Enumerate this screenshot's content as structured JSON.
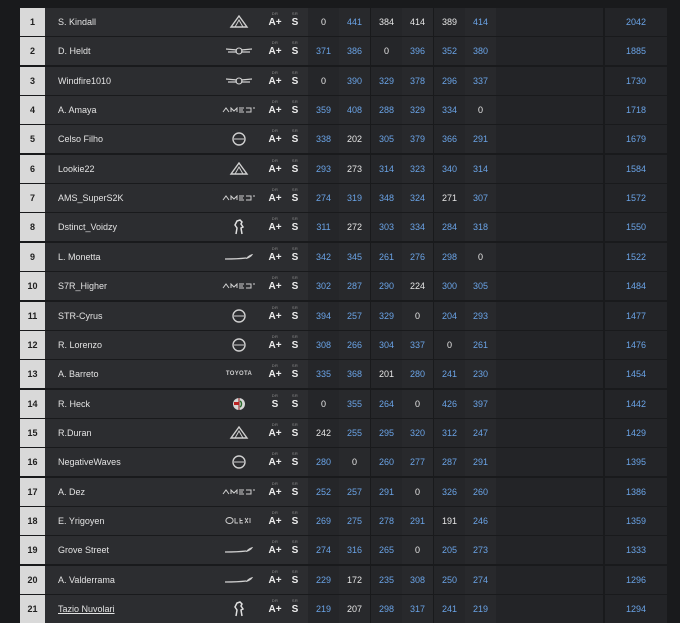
{
  "license_caps": {
    "dr": "DR",
    "sr": "SR"
  },
  "brand_colors": {
    "round_value": "#6aa3e6",
    "highlight_value": "#e6e6e6"
  },
  "rows": [
    {
      "pos": "1",
      "name": "S. Kindall",
      "logo": "alpine",
      "dr": "A+",
      "sr": "S",
      "rounds": [
        {
          "v": "0",
          "c": "w"
        },
        {
          "v": "441",
          "c": "b"
        },
        {
          "v": "384",
          "c": "w"
        },
        {
          "v": "414",
          "c": "w"
        },
        {
          "v": "389",
          "c": "w"
        },
        {
          "v": "414",
          "c": "b"
        }
      ],
      "total": "2042"
    },
    {
      "pos": "2",
      "name": "D. Heldt",
      "logo": "genesis",
      "dr": "A+",
      "sr": "S",
      "rounds": [
        {
          "v": "371",
          "c": "b"
        },
        {
          "v": "386",
          "c": "b"
        },
        {
          "v": "0",
          "c": "w"
        },
        {
          "v": "396",
          "c": "b"
        },
        {
          "v": "352",
          "c": "b"
        },
        {
          "v": "380",
          "c": "b"
        }
      ],
      "total": "1885"
    },
    {
      "pos": "3",
      "name": "Windfire1010",
      "logo": "genesis",
      "dr": "A+",
      "sr": "S",
      "rounds": [
        {
          "v": "0",
          "c": "w"
        },
        {
          "v": "390",
          "c": "b"
        },
        {
          "v": "329",
          "c": "b"
        },
        {
          "v": "378",
          "c": "b"
        },
        {
          "v": "296",
          "c": "b"
        },
        {
          "v": "337",
          "c": "b"
        }
      ],
      "total": "1730"
    },
    {
      "pos": "4",
      "name": "A. Amaya",
      "logo": "amg",
      "dr": "A+",
      "sr": "S",
      "rounds": [
        {
          "v": "359",
          "c": "b"
        },
        {
          "v": "408",
          "c": "b"
        },
        {
          "v": "288",
          "c": "b"
        },
        {
          "v": "329",
          "c": "b"
        },
        {
          "v": "334",
          "c": "b"
        },
        {
          "v": "0",
          "c": "w"
        }
      ],
      "total": "1718"
    },
    {
      "pos": "5",
      "name": "Celso Filho",
      "logo": "ring",
      "dr": "A+",
      "sr": "S",
      "rounds": [
        {
          "v": "338",
          "c": "b"
        },
        {
          "v": "202",
          "c": "w"
        },
        {
          "v": "305",
          "c": "b"
        },
        {
          "v": "379",
          "c": "b"
        },
        {
          "v": "366",
          "c": "b"
        },
        {
          "v": "291",
          "c": "b"
        }
      ],
      "total": "1679"
    },
    {
      "pos": "6",
      "name": "Lookie22",
      "logo": "alpine",
      "dr": "A+",
      "sr": "S",
      "rounds": [
        {
          "v": "293",
          "c": "b"
        },
        {
          "v": "273",
          "c": "w"
        },
        {
          "v": "314",
          "c": "b"
        },
        {
          "v": "323",
          "c": "b"
        },
        {
          "v": "340",
          "c": "b"
        },
        {
          "v": "314",
          "c": "b"
        }
      ],
      "total": "1584"
    },
    {
      "pos": "7",
      "name": "AMS_SuperS2K",
      "logo": "amg",
      "dr": "A+",
      "sr": "S",
      "rounds": [
        {
          "v": "274",
          "c": "b"
        },
        {
          "v": "319",
          "c": "b"
        },
        {
          "v": "348",
          "c": "b"
        },
        {
          "v": "324",
          "c": "b"
        },
        {
          "v": "271",
          "c": "w"
        },
        {
          "v": "307",
          "c": "b"
        }
      ],
      "total": "1572"
    },
    {
      "pos": "8",
      "name": "Dstinct_Voidzy",
      "logo": "horse",
      "dr": "A+",
      "sr": "S",
      "rounds": [
        {
          "v": "311",
          "c": "b"
        },
        {
          "v": "272",
          "c": "w"
        },
        {
          "v": "303",
          "c": "b"
        },
        {
          "v": "334",
          "c": "b"
        },
        {
          "v": "284",
          "c": "b"
        },
        {
          "v": "318",
          "c": "b"
        }
      ],
      "total": "1550"
    },
    {
      "pos": "9",
      "name": "L. Monetta",
      "logo": "mclaren",
      "dr": "A+",
      "sr": "S",
      "rounds": [
        {
          "v": "342",
          "c": "b"
        },
        {
          "v": "345",
          "c": "b"
        },
        {
          "v": "261",
          "c": "b"
        },
        {
          "v": "276",
          "c": "b"
        },
        {
          "v": "298",
          "c": "b"
        },
        {
          "v": "0",
          "c": "w"
        }
      ],
      "total": "1522"
    },
    {
      "pos": "10",
      "name": "S7R_Higher",
      "logo": "amg",
      "dr": "A+",
      "sr": "S",
      "rounds": [
        {
          "v": "302",
          "c": "b"
        },
        {
          "v": "287",
          "c": "b"
        },
        {
          "v": "290",
          "c": "b"
        },
        {
          "v": "224",
          "c": "w"
        },
        {
          "v": "300",
          "c": "b"
        },
        {
          "v": "305",
          "c": "b"
        }
      ],
      "total": "1484"
    },
    {
      "pos": "11",
      "name": "STR-Cyrus",
      "logo": "ring",
      "dr": "A+",
      "sr": "S",
      "rounds": [
        {
          "v": "394",
          "c": "b"
        },
        {
          "v": "257",
          "c": "b"
        },
        {
          "v": "329",
          "c": "b"
        },
        {
          "v": "0",
          "c": "w"
        },
        {
          "v": "204",
          "c": "b"
        },
        {
          "v": "293",
          "c": "b"
        }
      ],
      "total": "1477"
    },
    {
      "pos": "12",
      "name": "R. Lorenzo",
      "logo": "ring",
      "dr": "A+",
      "sr": "S",
      "rounds": [
        {
          "v": "308",
          "c": "b"
        },
        {
          "v": "266",
          "c": "b"
        },
        {
          "v": "304",
          "c": "b"
        },
        {
          "v": "337",
          "c": "b"
        },
        {
          "v": "0",
          "c": "w"
        },
        {
          "v": "261",
          "c": "b"
        }
      ],
      "total": "1476"
    },
    {
      "pos": "13",
      "name": "A. Barreto",
      "logo": "toyota",
      "dr": "A+",
      "sr": "S",
      "rounds": [
        {
          "v": "335",
          "c": "b"
        },
        {
          "v": "368",
          "c": "b"
        },
        {
          "v": "201",
          "c": "w"
        },
        {
          "v": "280",
          "c": "b"
        },
        {
          "v": "241",
          "c": "b"
        },
        {
          "v": "230",
          "c": "b"
        }
      ],
      "total": "1454"
    },
    {
      "pos": "14",
      "name": "R. Heck",
      "logo": "alfa",
      "dr": "S",
      "sr": "S",
      "rounds": [
        {
          "v": "0",
          "c": "w"
        },
        {
          "v": "355",
          "c": "b"
        },
        {
          "v": "264",
          "c": "b"
        },
        {
          "v": "0",
          "c": "w"
        },
        {
          "v": "426",
          "c": "b"
        },
        {
          "v": "397",
          "c": "b"
        }
      ],
      "total": "1442"
    },
    {
      "pos": "15",
      "name": "R.Duran",
      "logo": "alpine",
      "dr": "A+",
      "sr": "S",
      "rounds": [
        {
          "v": "242",
          "c": "w"
        },
        {
          "v": "255",
          "c": "b"
        },
        {
          "v": "295",
          "c": "b"
        },
        {
          "v": "320",
          "c": "b"
        },
        {
          "v": "312",
          "c": "b"
        },
        {
          "v": "247",
          "c": "b"
        }
      ],
      "total": "1429"
    },
    {
      "pos": "16",
      "name": "NegativeWaves",
      "logo": "ring",
      "dr": "A+",
      "sr": "S",
      "rounds": [
        {
          "v": "280",
          "c": "b"
        },
        {
          "v": "0",
          "c": "w"
        },
        {
          "v": "260",
          "c": "b"
        },
        {
          "v": "277",
          "c": "b"
        },
        {
          "v": "287",
          "c": "b"
        },
        {
          "v": "291",
          "c": "b"
        }
      ],
      "total": "1395"
    },
    {
      "pos": "17",
      "name": "A. Dez",
      "logo": "amg",
      "dr": "A+",
      "sr": "S",
      "rounds": [
        {
          "v": "252",
          "c": "b"
        },
        {
          "v": "257",
          "c": "b"
        },
        {
          "v": "291",
          "c": "b"
        },
        {
          "v": "0",
          "c": "w"
        },
        {
          "v": "326",
          "c": "b"
        },
        {
          "v": "260",
          "c": "b"
        }
      ],
      "total": "1386"
    },
    {
      "pos": "18",
      "name": "E. Yrigoyen",
      "logo": "lexus",
      "dr": "A+",
      "sr": "S",
      "rounds": [
        {
          "v": "269",
          "c": "b"
        },
        {
          "v": "275",
          "c": "b"
        },
        {
          "v": "278",
          "c": "b"
        },
        {
          "v": "291",
          "c": "b"
        },
        {
          "v": "191",
          "c": "w"
        },
        {
          "v": "246",
          "c": "b"
        }
      ],
      "total": "1359"
    },
    {
      "pos": "19",
      "name": "Grove Street",
      "logo": "mclaren",
      "dr": "A+",
      "sr": "S",
      "rounds": [
        {
          "v": "274",
          "c": "b"
        },
        {
          "v": "316",
          "c": "b"
        },
        {
          "v": "265",
          "c": "b"
        },
        {
          "v": "0",
          "c": "w"
        },
        {
          "v": "205",
          "c": "b"
        },
        {
          "v": "273",
          "c": "b"
        }
      ],
      "total": "1333"
    },
    {
      "pos": "20",
      "name": "A. Valderrama",
      "logo": "mclaren",
      "dr": "A+",
      "sr": "S",
      "rounds": [
        {
          "v": "229",
          "c": "b"
        },
        {
          "v": "172",
          "c": "w"
        },
        {
          "v": "235",
          "c": "b"
        },
        {
          "v": "308",
          "c": "b"
        },
        {
          "v": "250",
          "c": "b"
        },
        {
          "v": "274",
          "c": "b"
        }
      ],
      "total": "1296"
    },
    {
      "pos": "21",
      "name": "Tazio Nuvolari",
      "logo": "horse",
      "dr": "A+",
      "sr": "S",
      "link": true,
      "rounds": [
        {
          "v": "219",
          "c": "b"
        },
        {
          "v": "207",
          "c": "w"
        },
        {
          "v": "298",
          "c": "b"
        },
        {
          "v": "317",
          "c": "b"
        },
        {
          "v": "241",
          "c": "b"
        },
        {
          "v": "219",
          "c": "b"
        }
      ],
      "total": "1294"
    }
  ]
}
